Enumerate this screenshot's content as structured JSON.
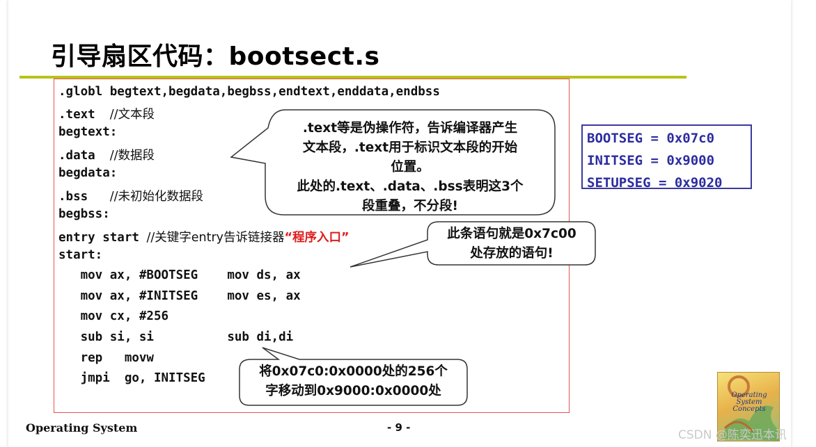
{
  "slide": {
    "title": "引导扇区代码：bootsect.s",
    "code_lines": [
      ".globl begtext,begdata,begbss,endtext,enddata,endbss",
      ".text  ",
      "begtext:",
      ".data  ",
      "begdata:",
      ".bss   ",
      "begbss:",
      "entry start ",
      "start:",
      "   mov ax, #BOOTSEG    mov ds, ax",
      "   mov ax, #INITSEG    mov es, ax",
      "   mov cx, #256",
      "   sub si, si          sub di,di",
      "   rep   movw",
      "   jmpi  go, INITSEG"
    ],
    "code_comments": {
      "text": "//文本段",
      "data": "//数据段",
      "bss": "//未初始化数据段",
      "entry": "//关键字entry告诉链接器",
      "entry_quote": "“程序入口”"
    },
    "segments": [
      "BOOTSEG = 0x07c0",
      "INITSEG = 0x9000",
      "SETUPSEG = 0x9020"
    ],
    "callouts": {
      "text_note": [
        ".text等是伪操作符，告诉编译器产生",
        "文本段，.text用于标识文本段的开始",
        "位置。",
        "此处的.text、.data、.bss表明这3个",
        "段重叠，不分段!"
      ],
      "addr_note": [
        "此条语句就是0x7c00",
        "处存放的语句!"
      ],
      "move_note": [
        "将0x07c0:0x0000处的256个",
        "字移动到0x9000:0x0000处"
      ]
    },
    "footer_left": "Operating System",
    "page_number": "- 9 -",
    "book_cover_text": "Operating System Concepts",
    "watermark": "CSDN @陈奕迅本讯"
  }
}
